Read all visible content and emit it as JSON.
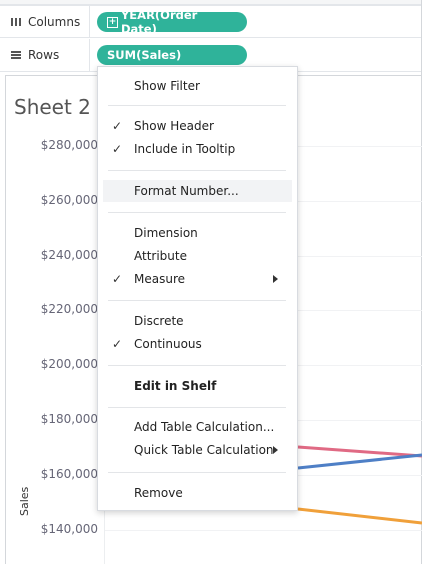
{
  "shelves": {
    "columns": {
      "label": "Columns",
      "icon": "columns-icon",
      "pill": "YEAR(Order Date)"
    },
    "rows": {
      "label": "Rows",
      "icon": "rows-icon",
      "pill": "SUM(Sales)"
    }
  },
  "sheet": {
    "title": "Sheet 2",
    "y_axis_title": "Sales",
    "y_ticks": [
      "$280,000",
      "$260,000",
      "$240,000",
      "$220,000",
      "$200,000",
      "$180,000",
      "$160,000",
      "$140,000"
    ]
  },
  "context_menu": {
    "items": [
      {
        "label": "Show Filter",
        "checked": false
      },
      {
        "label": "Show Header",
        "checked": true
      },
      {
        "label": "Include in Tooltip",
        "checked": true
      },
      {
        "label": "Format Number...",
        "checked": false,
        "highlighted": true
      },
      {
        "label": "Dimension",
        "checked": false
      },
      {
        "label": "Attribute",
        "checked": false
      },
      {
        "label": "Measure",
        "checked": true,
        "submenu": true
      },
      {
        "label": "Discrete",
        "checked": false
      },
      {
        "label": "Continuous",
        "checked": true
      },
      {
        "label": "Edit in Shelf",
        "checked": false,
        "bold": true
      },
      {
        "label": "Add Table Calculation...",
        "checked": false
      },
      {
        "label": "Quick Table Calculation",
        "checked": false,
        "submenu": true
      },
      {
        "label": "Remove",
        "checked": false
      }
    ],
    "check_glyph": "✓"
  },
  "colors": {
    "pill": "#2fb39a",
    "line_pink": "#e06a84",
    "line_blue": "#4e7fc6",
    "line_orange": "#f0a03a"
  }
}
